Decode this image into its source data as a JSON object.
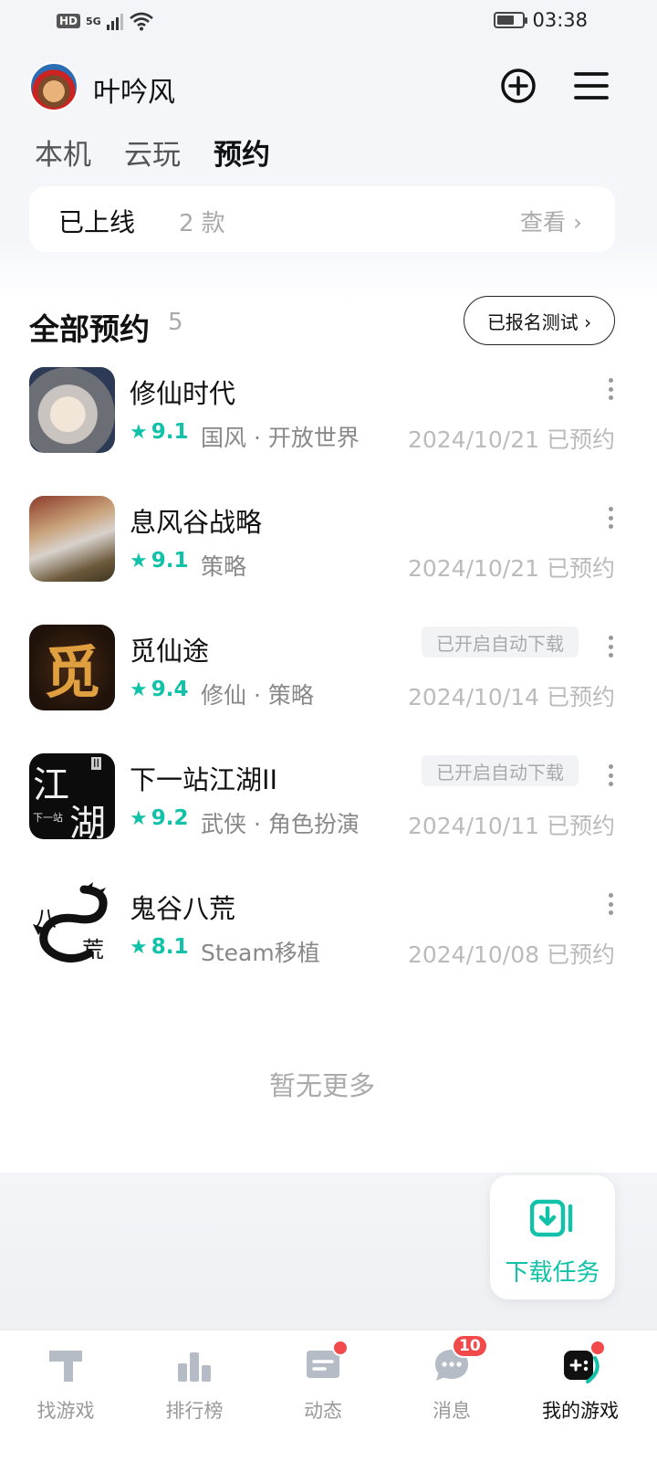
{
  "status_bar": {
    "hd": "HD",
    "network": "5G",
    "time": "03:38",
    "battery_level": 0.7
  },
  "header": {
    "username": "叶吟风"
  },
  "tabs": [
    {
      "label": "本机",
      "active": false
    },
    {
      "label": "云玩",
      "active": false
    },
    {
      "label": "预约",
      "active": true
    }
  ],
  "online": {
    "title": "已上线",
    "count": "2 款",
    "view": "查看 ›"
  },
  "section": {
    "title": "全部预约",
    "count": "5",
    "test_button": "已报名测试 ›"
  },
  "games": [
    {
      "name": "修仙时代",
      "rating": "9.1",
      "tags": "国风 · 开放世界",
      "date": "2024/10/21 已预约",
      "auto_download": ""
    },
    {
      "name": "息风谷战略",
      "rating": "9.1",
      "tags": "策略",
      "date": "2024/10/21 已预约",
      "auto_download": ""
    },
    {
      "name": "觅仙途",
      "rating": "9.4",
      "tags": "修仙 · 策略",
      "date": "2024/10/14 已预约",
      "auto_download": "已开启自动下载"
    },
    {
      "name": "下一站江湖II",
      "rating": "9.2",
      "tags": "武侠 · 角色扮演",
      "date": "2024/10/11 已预约",
      "auto_download": "已开启自动下载"
    },
    {
      "name": "鬼谷八荒",
      "rating": "8.1",
      "tags": "Steam移植",
      "date": "2024/10/08 已预约",
      "auto_download": ""
    }
  ],
  "game_icon_text": {
    "mi": "觅",
    "jiang": "江",
    "hu": "湖",
    "next": "下一站",
    "roman": "II",
    "ba": "八",
    "huang": "荒"
  },
  "footer_text": "暂无更多",
  "download_task": {
    "label": "下载任务"
  },
  "bottom_nav": [
    {
      "label": "找游戏",
      "icon": "find-game-icon"
    },
    {
      "label": "排行榜",
      "icon": "ranking-icon"
    },
    {
      "label": "动态",
      "icon": "feed-icon",
      "dot": true
    },
    {
      "label": "消息",
      "icon": "message-icon",
      "badge": "10"
    },
    {
      "label": "我的游戏",
      "icon": "my-games-icon",
      "dot": true,
      "active": true
    }
  ],
  "colors": {
    "accent": "#12c2a8",
    "badge_red": "#f24a4a"
  }
}
